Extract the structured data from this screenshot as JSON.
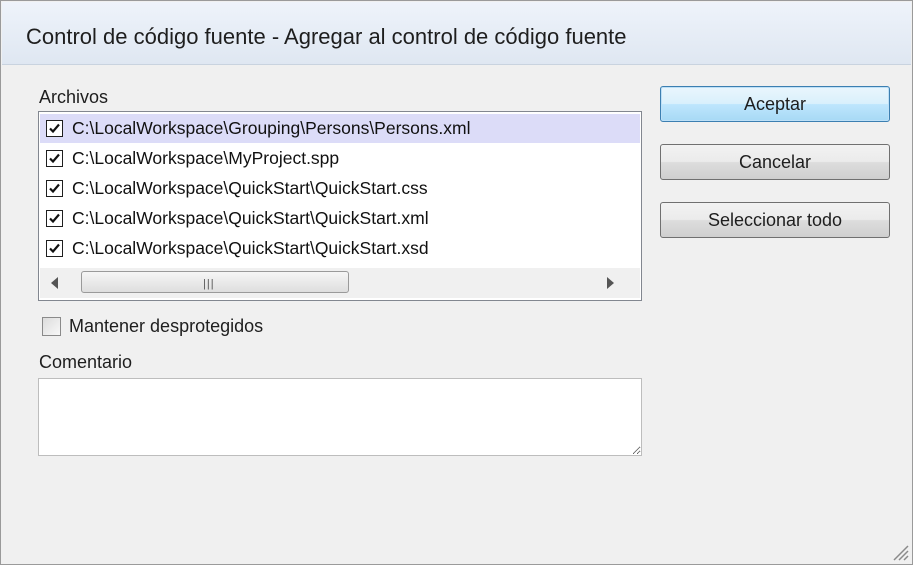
{
  "dialog": {
    "title": "Control de código fuente - Agregar al control de código fuente"
  },
  "files": {
    "label": "Archivos",
    "items": [
      {
        "path": "C:\\LocalWorkspace\\Grouping\\Persons\\Persons.xml",
        "checked": true,
        "selected": true
      },
      {
        "path": "C:\\LocalWorkspace\\MyProject.spp",
        "checked": true,
        "selected": false
      },
      {
        "path": "C:\\LocalWorkspace\\QuickStart\\QuickStart.css",
        "checked": true,
        "selected": false
      },
      {
        "path": "C:\\LocalWorkspace\\QuickStart\\QuickStart.xml",
        "checked": true,
        "selected": false
      },
      {
        "path": "C:\\LocalWorkspace\\QuickStart\\QuickStart.xsd",
        "checked": true,
        "selected": false
      }
    ]
  },
  "keep_checked_out": {
    "label": "Mantener desprotegidos",
    "checked": false
  },
  "comment": {
    "label": "Comentario",
    "value": ""
  },
  "buttons": {
    "ok": "Aceptar",
    "cancel": "Cancelar",
    "select_all": "Seleccionar todo"
  },
  "colors": {
    "selected_row": "#dcdcf8",
    "default_button_border": "#3c7fb1"
  }
}
